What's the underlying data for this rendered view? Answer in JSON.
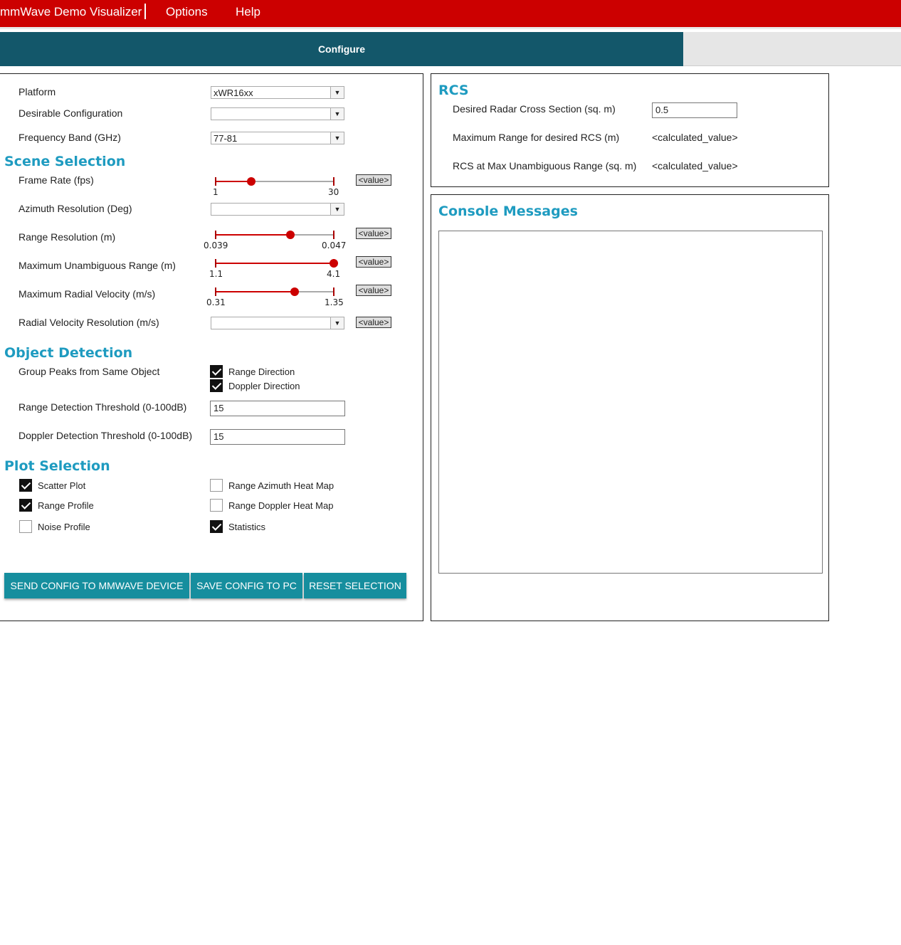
{
  "menu": {
    "app_title": "mmWave Demo Visualizer",
    "options": "Options",
    "help": "Help"
  },
  "tabs": [
    {
      "label": "Configure"
    }
  ],
  "colors": {
    "menu_bar": "#cc0000",
    "tab_bar": "#13576a",
    "section_title": "#1e9bc0",
    "button": "#168e9e",
    "slider": "#cc0000"
  },
  "config": {
    "platform": {
      "label": "Platform",
      "value": "xWR16xx"
    },
    "desirable_configuration": {
      "label": "Desirable Configuration",
      "value": ""
    },
    "frequency_band": {
      "label": "Frequency Band (GHz)",
      "value": "77-81"
    }
  },
  "scene": {
    "title": "Scene Selection",
    "frame_rate": {
      "label": "Frame Rate (fps)",
      "min": "1",
      "max": "30",
      "position": 0.3,
      "value": "<value>"
    },
    "azimuth_resolution": {
      "label": "Azimuth Resolution (Deg)",
      "value": ""
    },
    "range_resolution": {
      "label": "Range Resolution (m)",
      "min": "0.039",
      "max": "0.047",
      "position": 0.63,
      "value": "<value>"
    },
    "max_unambiguous_range": {
      "label": "Maximum Unambiguous Range (m)",
      "min": "1.1",
      "max": "4.1",
      "position": 1.0,
      "value": "<value>"
    },
    "max_radial_velocity": {
      "label": "Maximum Radial Velocity (m/s)",
      "min": "0.31",
      "max": "1.35",
      "position": 0.67,
      "value": "<value>"
    },
    "radial_velocity_resolution": {
      "label": "Radial Velocity Resolution (m/s)",
      "value": "",
      "value_box": "<value>"
    }
  },
  "detection": {
    "title": "Object Detection",
    "group_peaks_label": "Group Peaks from Same Object",
    "range_direction": {
      "label": "Range Direction",
      "checked": true
    },
    "doppler_direction": {
      "label": "Doppler Direction",
      "checked": true
    },
    "range_threshold": {
      "label": "Range Detection Threshold (0-100dB)",
      "value": "15"
    },
    "doppler_threshold": {
      "label": "Doppler Detection Threshold (0-100dB)",
      "value": "15"
    }
  },
  "plots": {
    "title": "Plot Selection",
    "scatter": {
      "label": "Scatter Plot",
      "checked": true
    },
    "range_profile": {
      "label": "Range Profile",
      "checked": true
    },
    "noise_profile": {
      "label": "Noise Profile",
      "checked": false
    },
    "range_azimuth": {
      "label": "Range Azimuth Heat Map",
      "checked": false
    },
    "range_doppler": {
      "label": "Range Doppler Heat Map",
      "checked": false
    },
    "statistics": {
      "label": "Statistics",
      "checked": true
    }
  },
  "buttons": {
    "send": "SEND CONFIG TO MMWAVE DEVICE",
    "save": "SAVE CONFIG TO PC",
    "reset": "RESET SELECTION"
  },
  "rcs": {
    "title": "RCS",
    "desired_label": "Desired Radar Cross Section (sq. m)",
    "desired_value": "0.5",
    "max_range_label": "Maximum Range for desired RCS (m)",
    "max_range_value": "<calculated_value>",
    "rcs_at_max_label": "RCS at Max Unambiguous Range (sq. m)",
    "rcs_at_max_value": "<calculated_value>"
  },
  "console": {
    "title": "Console Messages",
    "content": ""
  }
}
